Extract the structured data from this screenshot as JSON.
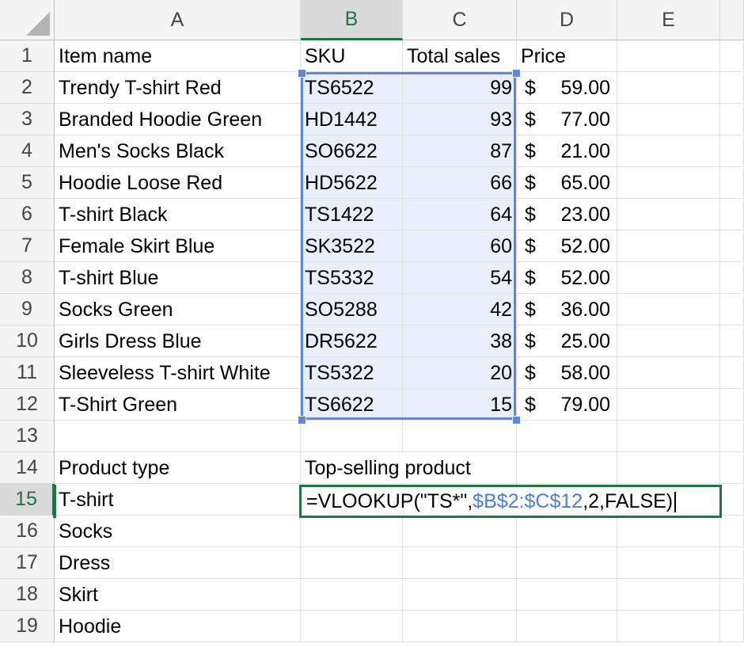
{
  "columns": [
    "A",
    "B",
    "C",
    "D",
    "E"
  ],
  "active_column": "B",
  "rows": [
    1,
    2,
    3,
    4,
    5,
    6,
    7,
    8,
    9,
    10,
    11,
    12,
    13,
    14,
    15,
    16,
    17,
    18,
    19
  ],
  "active_row": 15,
  "headers": {
    "item_name": "Item name",
    "sku": "SKU",
    "total_sales": "Total sales",
    "price": "Price"
  },
  "items": [
    {
      "name": "Trendy T-shirt Red",
      "sku": "TS6522",
      "sales": "99",
      "currency": "$",
      "price": "59.00"
    },
    {
      "name": "Branded Hoodie Green",
      "sku": "HD1442",
      "sales": "93",
      "currency": "$",
      "price": "77.00"
    },
    {
      "name": "Men's Socks Black",
      "sku": "SO6622",
      "sales": "87",
      "currency": "$",
      "price": "21.00"
    },
    {
      "name": "Hoodie Loose Red",
      "sku": "HD5622",
      "sales": "66",
      "currency": "$",
      "price": "65.00"
    },
    {
      "name": "T-shirt Black",
      "sku": "TS1422",
      "sales": "64",
      "currency": "$",
      "price": "23.00"
    },
    {
      "name": "Female Skirt Blue",
      "sku": "SK3522",
      "sales": "60",
      "currency": "$",
      "price": "52.00"
    },
    {
      "name": "T-shirt Blue",
      "sku": "TS5332",
      "sales": "54",
      "currency": "$",
      "price": "52.00"
    },
    {
      "name": "Socks Green",
      "sku": "SO5288",
      "sales": "42",
      "currency": "$",
      "price": "36.00"
    },
    {
      "name": "Girls Dress Blue",
      "sku": "DR5622",
      "sales": "38",
      "currency": "$",
      "price": "25.00"
    },
    {
      "name": "Sleeveless T-shirt White",
      "sku": "TS5322",
      "sales": "20",
      "currency": "$",
      "price": "58.00"
    },
    {
      "name": "T-Shirt Green",
      "sku": "TS6622",
      "sales": "15",
      "currency": "$",
      "price": "79.00"
    }
  ],
  "product_type_label": "Product type",
  "top_selling_label": "Top-selling product",
  "product_types": [
    "T-shirt",
    "Socks",
    "Dress",
    "Skirt",
    "Hoodie"
  ],
  "formula": {
    "prefix": "=VLOOKUP(\"TS*\",",
    "range_ref": "$B$2:$C$12",
    "suffix": ",2,FALSE)"
  },
  "colors": {
    "accent_green": "#217346",
    "range_blue": "#5b8ad8",
    "range_fill": "#e9effa"
  }
}
